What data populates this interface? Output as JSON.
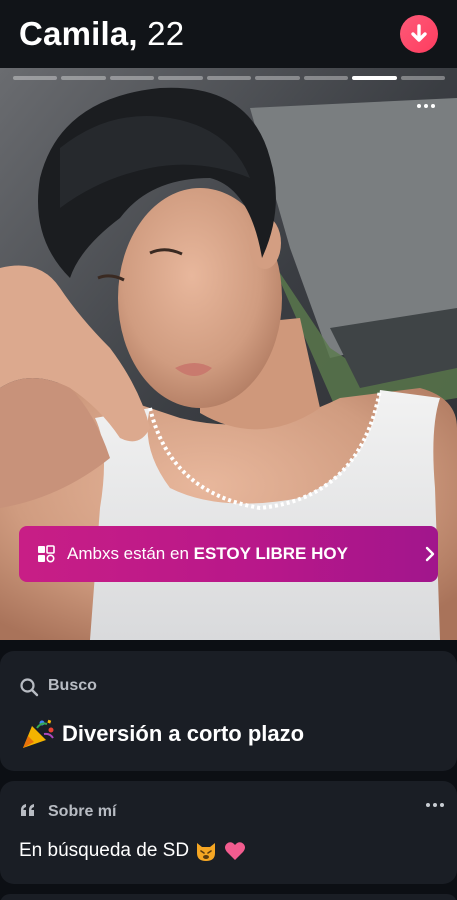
{
  "profile": {
    "name": "Camila,",
    "age": "22"
  },
  "header": {
    "collapse_icon": "arrow-down-icon",
    "accent": "#fe3c5f"
  },
  "photo": {
    "segment_count": 9,
    "active_segment": 8,
    "more_icon": "more-horizontal-icon"
  },
  "badge": {
    "icon": "stacked-squares-icon",
    "text_prefix": "Ambxs están en ",
    "text_strong": "ESTOY LIBRE HOY",
    "chevron_icon": "chevron-right-icon",
    "color": "#c81e86"
  },
  "looking_for": {
    "icon": "search-icon",
    "label": "Busco",
    "emoji": "party-popper-emoji",
    "value": "Diversión a corto plazo"
  },
  "about": {
    "icon": "quote-icon",
    "label": "Sobre mí",
    "more_icon": "more-horizontal-icon",
    "text": "En búsqueda de SD",
    "emojis": [
      "cat-face-emoji",
      "pink-heart-emoji"
    ]
  }
}
